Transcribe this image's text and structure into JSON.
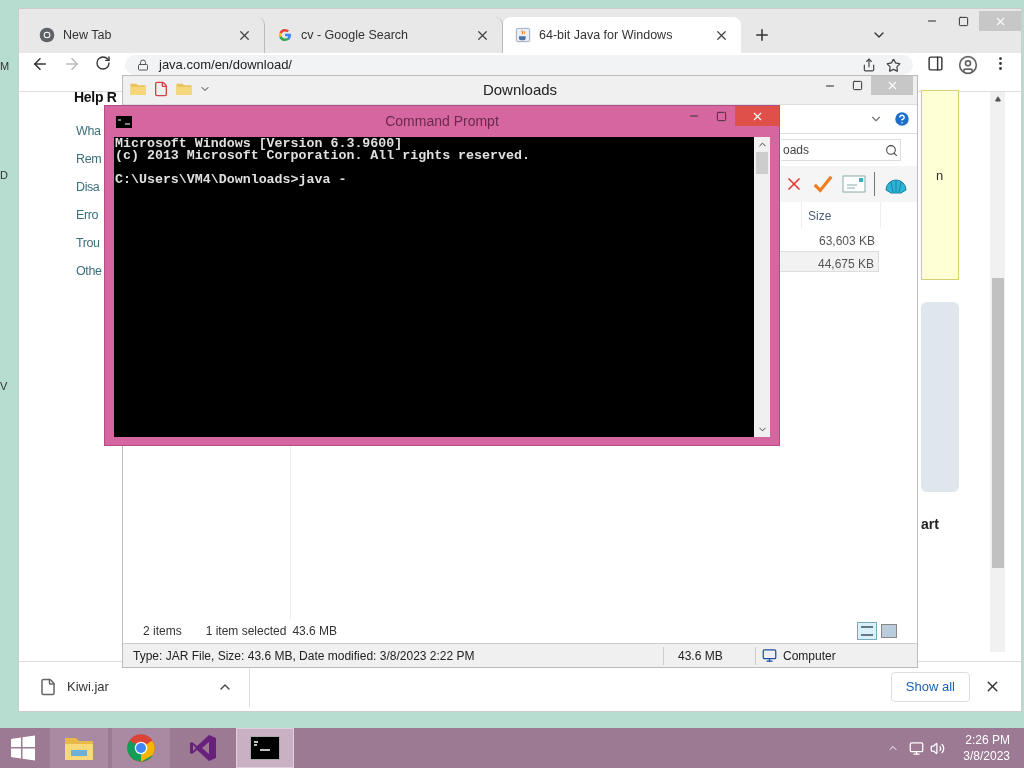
{
  "desktop_labels": [
    "M",
    "D",
    "V"
  ],
  "browser": {
    "tabs": [
      {
        "title": "New Tab",
        "selected": false,
        "kind": "chrome"
      },
      {
        "title": "cv - Google Search",
        "selected": false,
        "kind": "google"
      },
      {
        "title": "64-bit Java for Windows",
        "selected": true,
        "kind": "java"
      }
    ],
    "address": "java.com/en/download/",
    "forward_disabled": true,
    "page": {
      "heading": "Help R",
      "links": [
        "Wha",
        "Rem",
        "Disa",
        "Erro",
        "Trou",
        "Othe"
      ],
      "side_note": "n",
      "side_heading": "art"
    },
    "downloads_bar": {
      "file": "Kiwi.jar",
      "show_all": "Show all"
    }
  },
  "explorer": {
    "title": "Downloads",
    "search_value": "oads",
    "column": "Size",
    "rows": [
      {
        "size": "63,603 KB",
        "selected": false
      },
      {
        "size": "44,675 KB",
        "selected": true
      }
    ],
    "item_count": "2 items",
    "selection": "1 item selected",
    "selection_size": "43.6 MB",
    "status_details": "Type: JAR File, Size: 43.6 MB, Date modified: 3/8/2023 2:22 PM",
    "status_size": "43.6 MB",
    "status_location": "Computer"
  },
  "console": {
    "title": "Command Prompt",
    "banner": [
      "Microsoft Windows [Version 6.3.9600]",
      "(c) 2013 Microsoft Corporation. All rights reserved."
    ],
    "prompt": "C:\\Users\\VM4\\Downloads>java -"
  },
  "taskbar": {
    "apps": [
      {
        "kind": "explorer",
        "running": true,
        "selected": false
      },
      {
        "kind": "chrome",
        "running": true,
        "selected": false
      },
      {
        "kind": "vs",
        "running": false,
        "selected": false
      },
      {
        "kind": "cmd",
        "running": true,
        "selected": true
      }
    ],
    "time": "2:26 PM",
    "date": "3/8/2023"
  }
}
